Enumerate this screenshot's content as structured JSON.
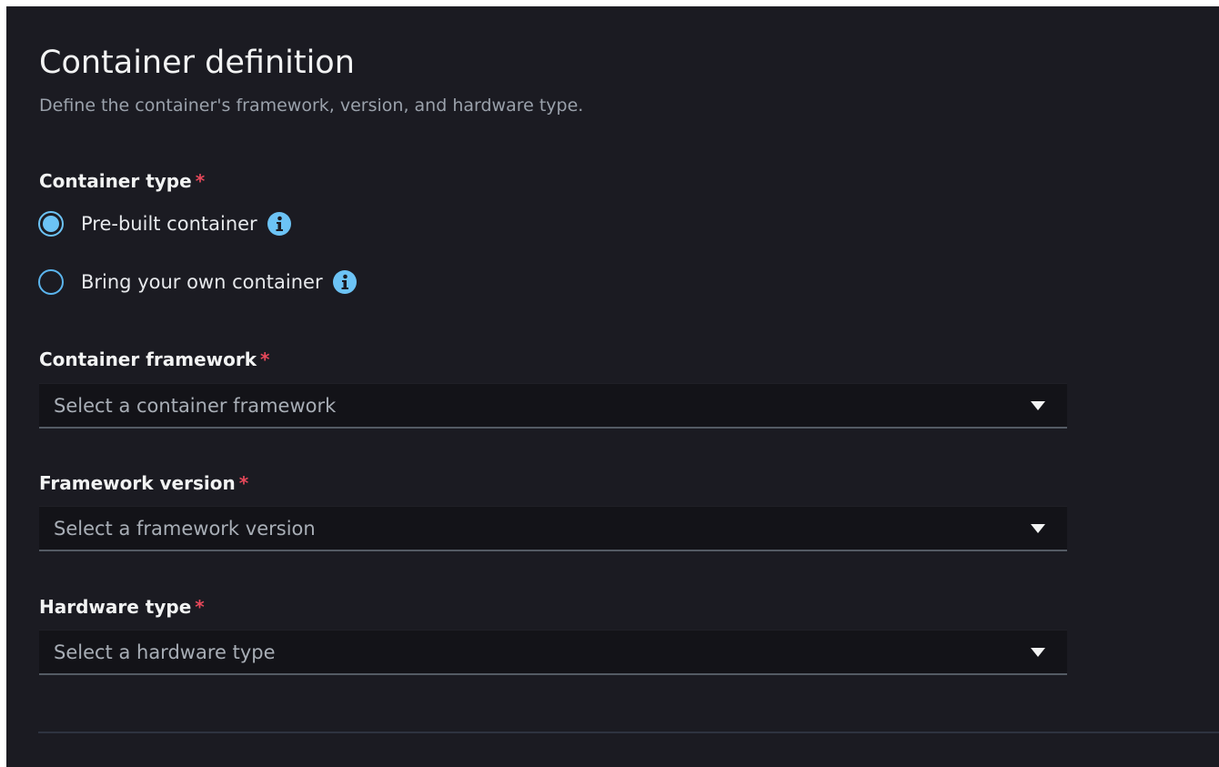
{
  "section": {
    "title": "Container definition",
    "description": "Define the container's framework, version, and hardware type."
  },
  "container_type": {
    "label": "Container type",
    "required_marker": "*",
    "options": [
      {
        "label": "Pre-built container",
        "checked": true
      },
      {
        "label": "Bring your own container",
        "checked": false
      }
    ],
    "info_icon": "info-icon"
  },
  "container_framework": {
    "label": "Container framework",
    "required_marker": "*",
    "placeholder": "Select a container framework",
    "caret_icon": "caret-down-icon"
  },
  "framework_version": {
    "label": "Framework version",
    "required_marker": "*",
    "placeholder": "Select a framework version",
    "caret_icon": "caret-down-icon"
  },
  "hardware_type": {
    "label": "Hardware type",
    "required_marker": "*",
    "placeholder": "Select a hardware type",
    "caret_icon": "caret-down-icon"
  },
  "colors": {
    "background": "#1b1b22",
    "radio_accent": "#6cc3f5",
    "required": "#e6485a",
    "select_background": "#131318"
  }
}
